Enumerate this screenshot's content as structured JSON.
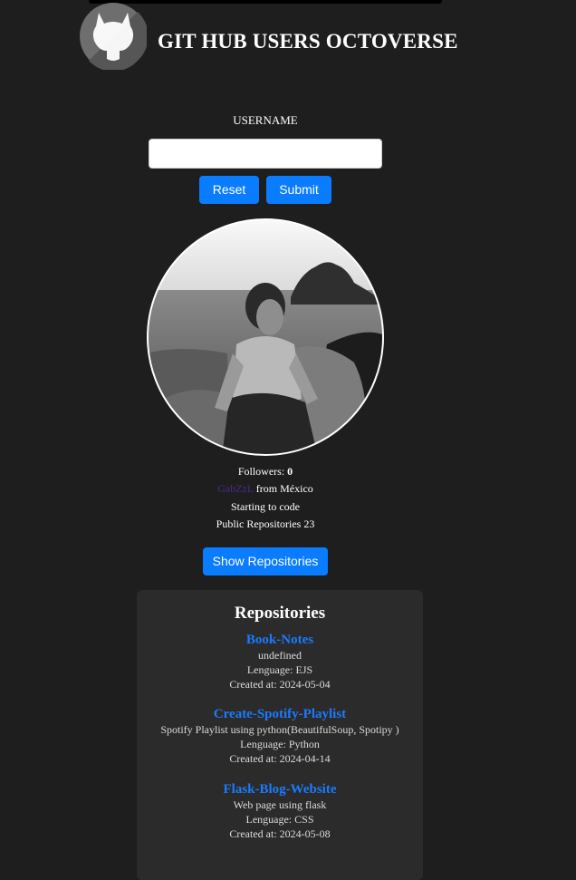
{
  "app": {
    "title": "GIT HUB USERS OCTOVERSE"
  },
  "form": {
    "label": "USERNAME",
    "username_value": "",
    "username_placeholder": "",
    "reset_label": "Reset",
    "submit_label": "Submit"
  },
  "profile": {
    "followers_label": "Followers:",
    "followers_count": "0",
    "login": "GabZzL",
    "location_prefix": "from",
    "location": "México",
    "bio": "Starting to code",
    "public_repos_label": "Public Repositories",
    "public_repos_count": "23",
    "show_repos_label": "Show Repositories"
  },
  "repositories": {
    "heading": "Repositories",
    "language_label": "Lenguage:",
    "created_label": "Created at:",
    "items": [
      {
        "name": "Book-Notes",
        "description": "undefined",
        "language": "EJS",
        "created_at": "2024-05-04"
      },
      {
        "name": "Create-Spotify-Playlist",
        "description": "Spotify Playlist using python(BeautifulSoup, Spotipy )",
        "language": "Python",
        "created_at": "2024-04-14"
      },
      {
        "name": "Flask-Blog-Website",
        "description": "Web page using flask",
        "language": "CSS",
        "created_at": "2024-05-08"
      }
    ]
  },
  "colors": {
    "background": "#1e1e1e",
    "card": "#2b2b2b",
    "button": "#0a7cff",
    "repo_link": "#1a7bff",
    "login_link": "#4b2a8a"
  },
  "icons": {
    "logo": "github-octocat-icon"
  }
}
